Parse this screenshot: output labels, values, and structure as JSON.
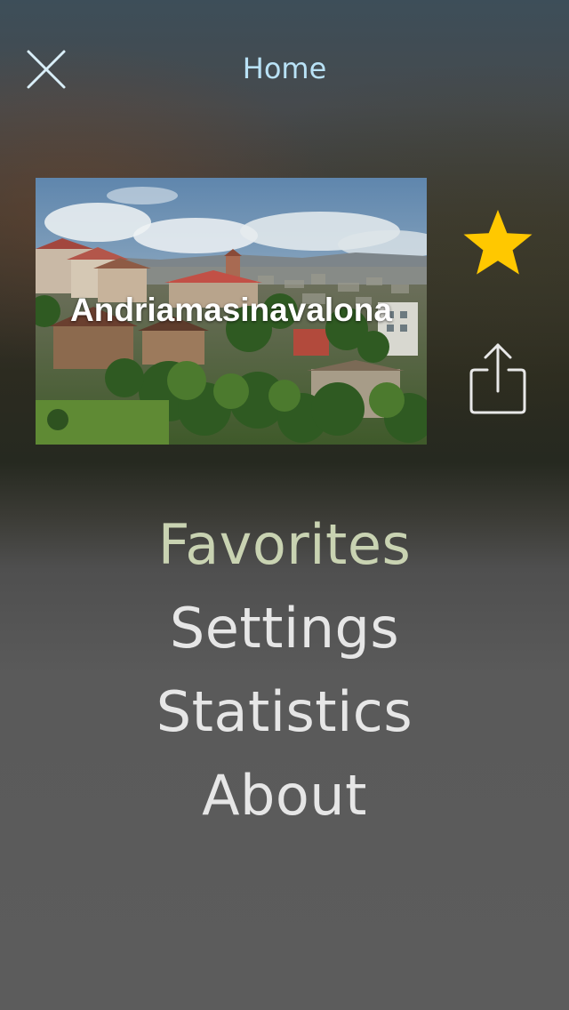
{
  "header": {
    "title": "Home",
    "close_icon": "close-icon"
  },
  "featured": {
    "label": "Andriamasinavalona",
    "image_icon": "city-photo"
  },
  "actions": {
    "favorite_icon": "star-icon",
    "favorite_color": "#ffc800",
    "share_icon": "share-icon"
  },
  "menu": {
    "items": [
      {
        "label": "Favorites",
        "active": true
      },
      {
        "label": "Settings",
        "active": false
      },
      {
        "label": "Statistics",
        "active": false
      },
      {
        "label": "About",
        "active": false
      }
    ]
  },
  "colors": {
    "title": "#b9e2f6",
    "menu_active": "#c9d3b2",
    "menu_default": "#e6e6e6"
  }
}
